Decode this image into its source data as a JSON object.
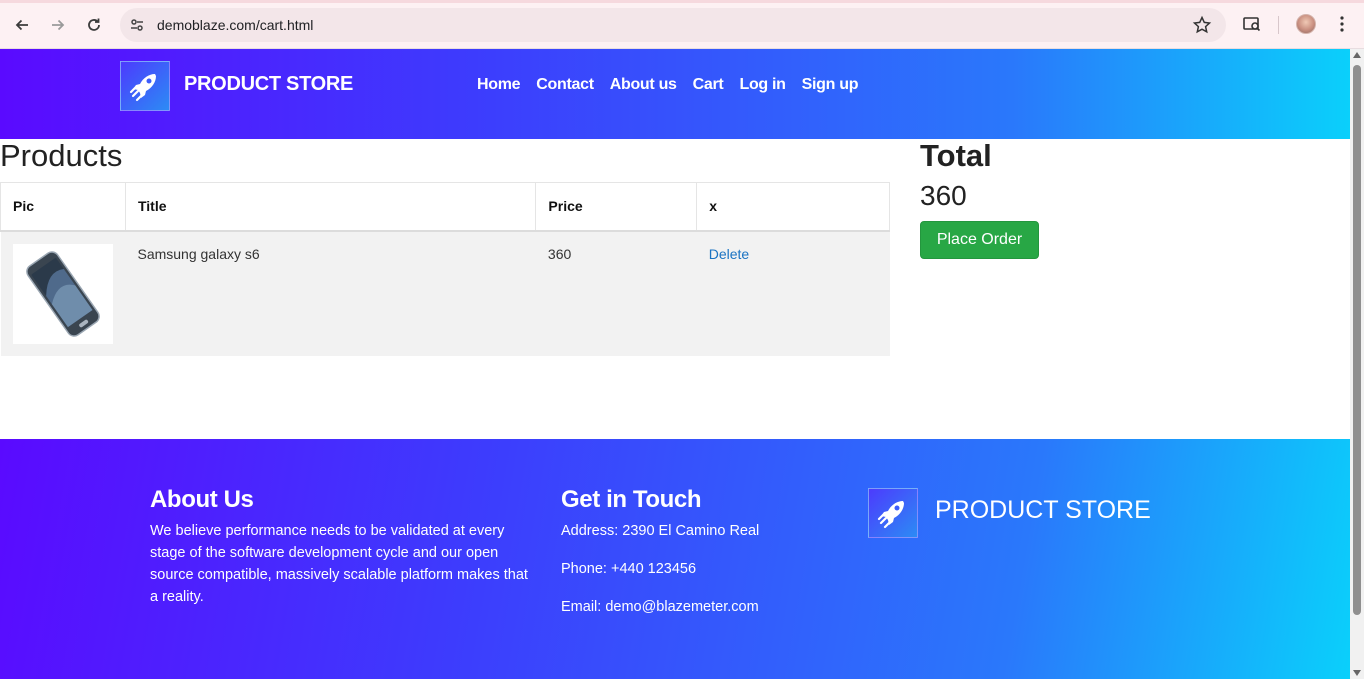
{
  "browser": {
    "url": "demoblaze.com/cart.html"
  },
  "navbar": {
    "brand": "PRODUCT STORE",
    "links": [
      "Home",
      "Contact",
      "About us",
      "Cart",
      "Log in",
      "Sign up"
    ]
  },
  "cart": {
    "heading": "Products",
    "columns": [
      "Pic",
      "Title",
      "Price",
      "x"
    ],
    "rows": [
      {
        "title": "Samsung galaxy s6",
        "price": "360",
        "action": "Delete"
      }
    ]
  },
  "summary": {
    "heading": "Total",
    "total": "360",
    "button": "Place Order"
  },
  "footer": {
    "about_heading": "About Us",
    "about_text": "We believe performance needs to be validated at every stage of the software development cycle and our open source compatible, massively scalable platform makes that a reality.",
    "contact_heading": "Get in Touch",
    "address": "Address: 2390 El Camino Real",
    "phone": "Phone: +440 123456",
    "email": "Email: demo@blazemeter.com",
    "brand": "PRODUCT STORE"
  },
  "colors": {
    "gradient_start": "#5a0aff",
    "gradient_end": "#0ad0fb",
    "button_green": "#28a745",
    "link_blue": "#1a73c2"
  }
}
